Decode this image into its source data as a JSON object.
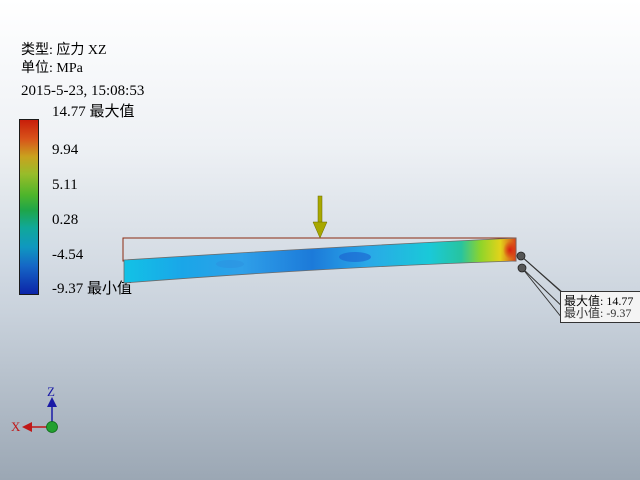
{
  "header": {
    "type_label": "类型: 应力 XZ",
    "unit_label": "单位: MPa",
    "timestamp": "2015-5-23, 15:08:53"
  },
  "legend": {
    "max_label": "14.77 最大值",
    "ticks": [
      "9.94",
      "5.11",
      "0.28",
      "-4.54"
    ],
    "min_label": "-9.37 最小值"
  },
  "callout": {
    "max_text": "最大值: 14.77",
    "min_text": "最小值: -9.37"
  },
  "axes": {
    "z": "Z",
    "x": "X"
  },
  "colors": {
    "stress_max": "#c81e0a",
    "stress_min": "#0c24a8",
    "load_arrow": "#a8a800",
    "outline": "#8b2a10"
  },
  "icons": {
    "load": "load-arrow-icon",
    "triad": "coordinate-triad-icon"
  }
}
